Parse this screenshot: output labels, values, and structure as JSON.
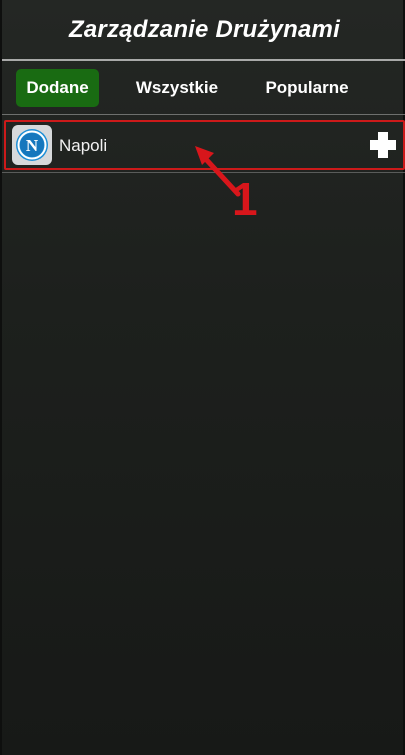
{
  "header": {
    "title": "Zarządzanie Drużynami"
  },
  "tabs": [
    {
      "label": "Dodane",
      "active": true
    },
    {
      "label": "Wszystkie",
      "active": false
    },
    {
      "label": "Popularne",
      "active": false
    }
  ],
  "teams": [
    {
      "name": "Napoli",
      "logo_letter": "N",
      "action_icon": "plus-icon"
    }
  ],
  "annotation": {
    "label": "1"
  },
  "colors": {
    "accent_tab": "#196b12",
    "highlight_border": "#cc1a1a",
    "annotation": "#d8161b"
  }
}
